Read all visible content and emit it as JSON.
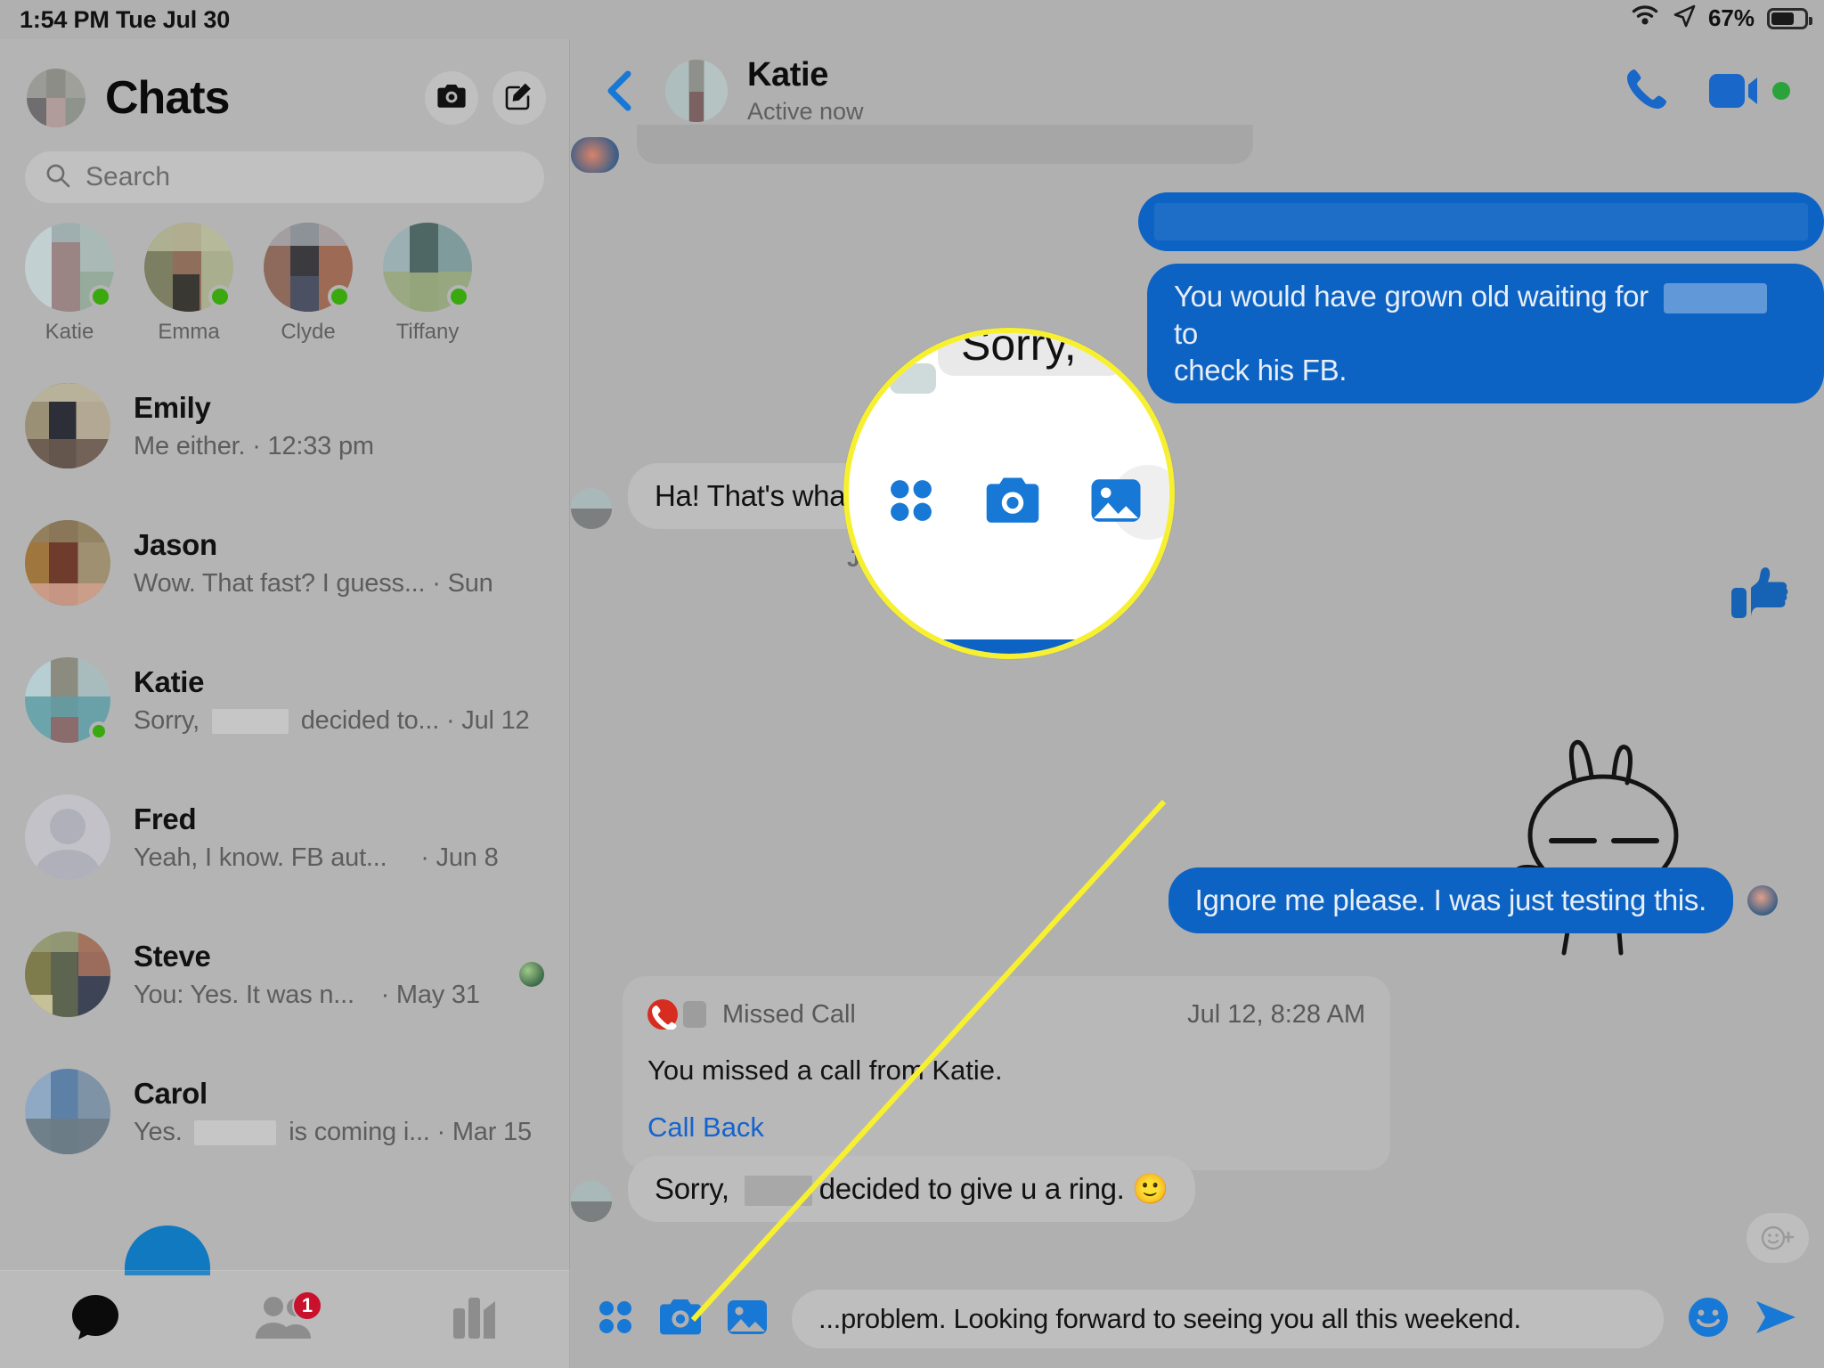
{
  "status_bar": {
    "time": "1:54 PM",
    "date": "Tue Jul 30",
    "battery_percent": "67%",
    "wifi_icon": "wifi-icon",
    "location_icon": "location-arrow-icon",
    "battery_icon": "battery-icon"
  },
  "sidebar": {
    "title": "Chats",
    "avatar_name": "my-profile-avatar",
    "camera_button": "camera-icon",
    "compose_button": "compose-icon",
    "search": {
      "placeholder": "Search",
      "icon": "search-icon"
    },
    "stories": [
      {
        "name": "Katie",
        "active": true
      },
      {
        "name": "Emma",
        "active": true
      },
      {
        "name": "Clyde",
        "active": true
      },
      {
        "name": "Tiffany",
        "active": true
      }
    ],
    "chats": [
      {
        "name": "Emily",
        "snippet_before": "Me either. · 12:33 pm",
        "snippet_after": "",
        "redacted": false,
        "time": "",
        "online": false,
        "seen": false
      },
      {
        "name": "Jason",
        "snippet_before": "Wow. That fast? I guess... · Sun",
        "snippet_after": "",
        "redacted": false,
        "time": "",
        "online": false,
        "seen": false
      },
      {
        "name": "Katie",
        "snippet_before": "Sorry,",
        "snippet_after": "decided to... · Jul 12",
        "redacted": true,
        "time": "",
        "online": true,
        "seen": false
      },
      {
        "name": "Fred",
        "snippet_before": "Yeah, I know. FB aut...",
        "snippet_after": "· Jun 8",
        "redacted": false,
        "time": "",
        "online": false,
        "seen": false
      },
      {
        "name": "Steve",
        "snippet_before": "You: Yes. It was n...",
        "snippet_after": "· May 31",
        "redacted": false,
        "time": "",
        "online": false,
        "seen": true
      },
      {
        "name": "Carol",
        "snippet_before": "Yes.",
        "snippet_after": "is coming i... · Mar 15",
        "redacted": true,
        "time": "",
        "online": false,
        "seen": false
      }
    ],
    "tabs": [
      {
        "name": "chats-tab",
        "icon": "chat-bubble-icon",
        "badge": "",
        "active": true
      },
      {
        "name": "people-tab",
        "icon": "people-icon",
        "badge": "1",
        "active": false
      },
      {
        "name": "discover-tab",
        "icon": "bar-chart-icon",
        "badge": "",
        "active": false
      }
    ]
  },
  "conversation": {
    "header": {
      "back_icon": "back-chevron-icon",
      "name": "Katie",
      "status": "Active now",
      "call_icon": "phone-icon",
      "video_icon": "video-camera-icon",
      "video_active": true
    },
    "day_divider": "JUN 8",
    "messages": [
      {
        "id": "m1",
        "side": "out",
        "text": "",
        "redacted_full": true
      },
      {
        "id": "m2",
        "side": "out",
        "text_a": "You would have grown old waiting for",
        "text_b": "to",
        "text_c": "check his FB.",
        "redacted_inline": true
      },
      {
        "id": "m3",
        "side": "in",
        "text": "Ha! That's what I thought. Thanks!"
      },
      {
        "id": "m4",
        "side": "out",
        "text": "Ignore me please. I was just testing this."
      },
      {
        "id": "m5",
        "side": "in",
        "text_a": "Sorry,",
        "text_b": "decided to give u a ring.",
        "emoji": "🙂",
        "redacted_inline": true
      }
    ],
    "thumbs_up_sticker": "thumbs-up-sticker",
    "rabbit_sticker": "rabbit-sticker",
    "reaction_button": "add-reaction-button",
    "missed_call": {
      "label": "Missed Call",
      "timestamp": "Jul 12, 8:28 AM",
      "body": "You missed a call from Katie.",
      "action": "Call Back",
      "icon": "missed-call-icon"
    },
    "composer": {
      "apps_icon": "four-dots-icon",
      "camera_icon": "camera-icon",
      "gallery_icon": "photo-gallery-icon",
      "text": "...problem. Looking forward to seeing you all this weekend.",
      "emoji_icon": "emoji-smiley-icon",
      "send_icon": "send-arrow-icon"
    }
  },
  "callout": {
    "magnified_text": "Sorry,",
    "day_label": "JUN 8",
    "icons": [
      "four-dots-icon",
      "camera-icon",
      "photo-gallery-icon"
    ],
    "ring_color": "#f7f030",
    "pointer_line_color": "#f7f030"
  },
  "colors": {
    "accent_blue": "#0d63c4",
    "icon_blue": "#1778d6",
    "link_blue": "#1463cf",
    "badge_red": "#c9102d",
    "online_green": "#3aa80f",
    "bg_gray": "#b0b0b0",
    "bubble_in": "#bdbdbd",
    "highlight_yellow": "#f7f030"
  }
}
